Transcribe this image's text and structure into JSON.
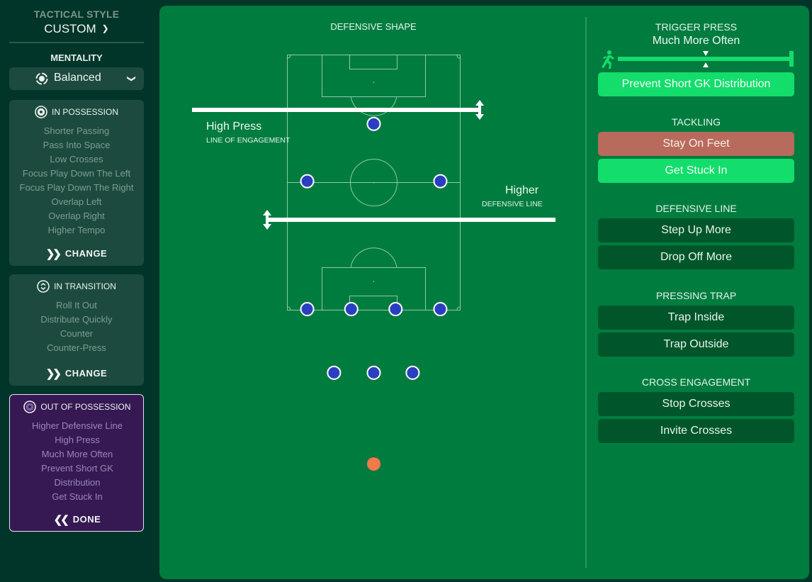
{
  "sidebar": {
    "tactical_style_label": "TACTICAL STYLE",
    "tactical_style_value": "CUSTOM",
    "mentality_label": "MENTALITY",
    "mentality_value": "Balanced",
    "in_possession": {
      "title": "IN POSSESSION",
      "items": [
        "Shorter Passing",
        "Pass Into Space",
        "Low Crosses",
        "Focus Play Down The Left",
        "Focus Play Down The Right",
        "Overlap Left",
        "Overlap Right",
        "Higher Tempo"
      ],
      "action": "CHANGE"
    },
    "in_transition": {
      "title": "IN TRANSITION",
      "items": [
        "Roll It Out",
        "Distribute Quickly",
        "Counter",
        "Counter-Press"
      ],
      "action": "CHANGE"
    },
    "out_of_possession": {
      "title": "OUT OF POSSESSION",
      "items": [
        "Higher Defensive Line",
        "High Press",
        "Much More Often",
        "Prevent Short GK",
        "Distribution",
        "Get Stuck In"
      ],
      "action": "DONE"
    }
  },
  "shape": {
    "title": "DEFENSIVE SHAPE",
    "line_of_engagement": {
      "value": "High Press",
      "label": "LINE OF ENGAGEMENT"
    },
    "defensive_line": {
      "value": "Higher",
      "label": "DEFENSIVE LINE"
    },
    "players": [
      {
        "role": "striker",
        "col": 0.5,
        "row": 0.216,
        "team": "outfield"
      },
      {
        "role": "att-mid-left",
        "col": 0.115,
        "row": 0.316,
        "team": "outfield"
      },
      {
        "role": "att-mid-right",
        "col": 0.885,
        "row": 0.316,
        "team": "outfield"
      },
      {
        "role": "mid-left",
        "col": 0.115,
        "row": 0.539,
        "team": "outfield"
      },
      {
        "role": "mid-center-left",
        "col": 0.37,
        "row": 0.539,
        "team": "outfield"
      },
      {
        "role": "mid-center-right",
        "col": 0.626,
        "row": 0.539,
        "team": "outfield"
      },
      {
        "role": "mid-right",
        "col": 0.885,
        "row": 0.539,
        "team": "outfield"
      },
      {
        "role": "cb-left",
        "col": 0.27,
        "row": 0.65,
        "team": "outfield"
      },
      {
        "role": "cb-center",
        "col": 0.5,
        "row": 0.65,
        "team": "outfield"
      },
      {
        "role": "cb-right",
        "col": 0.725,
        "row": 0.65,
        "team": "outfield"
      },
      {
        "role": "goalkeeper",
        "col": 0.5,
        "row": 0.809,
        "team": "goalkeeper"
      }
    ],
    "colors": {
      "outfield": "#2a3fbf",
      "goalkeeper": "#f37a4a"
    }
  },
  "right": {
    "trigger_press": {
      "title": "TRIGGER PRESS",
      "value": "Much More Often",
      "slider_fraction": 0.5,
      "toggle": {
        "label": "Prevent Short GK Distribution",
        "active": true
      }
    },
    "tackling": {
      "title": "TACKLING",
      "options": [
        {
          "label": "Stay On Feet",
          "state": "disabled"
        },
        {
          "label": "Get Stuck In",
          "state": "active"
        }
      ]
    },
    "defensive_line": {
      "title": "DEFENSIVE LINE",
      "options": [
        {
          "label": "Step Up More",
          "state": "off"
        },
        {
          "label": "Drop Off More",
          "state": "off"
        }
      ]
    },
    "pressing_trap": {
      "title": "PRESSING TRAP",
      "options": [
        {
          "label": "Trap Inside",
          "state": "off"
        },
        {
          "label": "Trap Outside",
          "state": "off"
        }
      ]
    },
    "cross_engagement": {
      "title": "CROSS ENGAGEMENT",
      "options": [
        {
          "label": "Stop Crosses",
          "state": "off"
        },
        {
          "label": "Invite Crosses",
          "state": "off"
        }
      ]
    }
  },
  "colors": {
    "background": "#023529",
    "panel": "#007c3f",
    "accent_green": "#13dd6b",
    "disabled_red": "#b86b5c",
    "card_bg": "#1c4a3e",
    "oop_card_bg": "#361853"
  }
}
